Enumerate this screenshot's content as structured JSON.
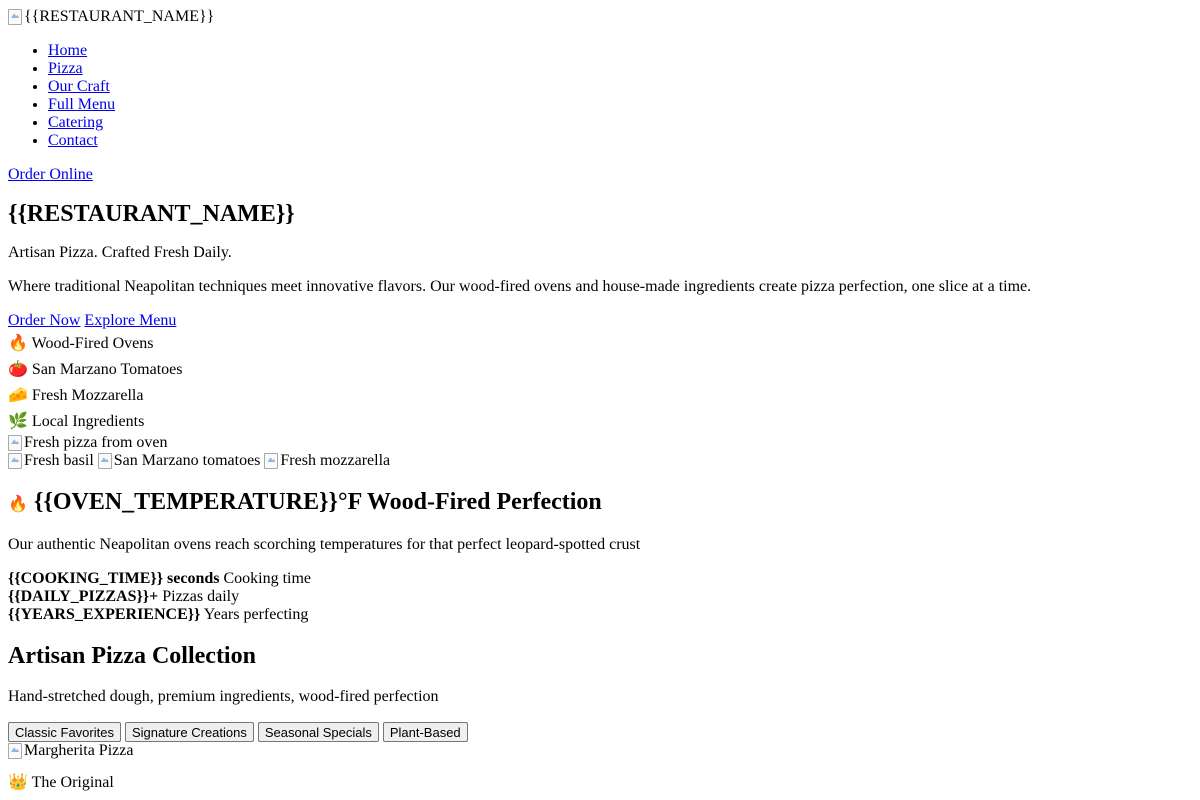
{
  "header": {
    "logo_alt": "{{RESTAURANT_NAME}}",
    "nav": [
      {
        "label": "Home"
      },
      {
        "label": "Pizza"
      },
      {
        "label": "Our Craft"
      },
      {
        "label": "Full Menu"
      },
      {
        "label": "Catering"
      },
      {
        "label": "Contact"
      }
    ],
    "order_online": "Order Online"
  },
  "hero": {
    "title": "{{RESTAURANT_NAME}}",
    "tagline": "Artisan Pizza. Crafted Fresh Daily.",
    "description": "Where traditional Neapolitan techniques meet innovative flavors. Our wood-fired ovens and house-made ingredients create pizza perfection, one slice at a time.",
    "order_now": "Order Now",
    "explore_menu": "Explore Menu",
    "features": [
      {
        "icon": "🔥",
        "icon_name": "fire-icon",
        "label": "Wood-Fired Ovens"
      },
      {
        "icon": "🍅",
        "icon_name": "tomato-icon",
        "label": "San Marzano Tomatoes"
      },
      {
        "icon": "🧀",
        "icon_name": "cheese-icon",
        "label": "Fresh Mozzarella"
      },
      {
        "icon": "🌿",
        "icon_name": "herb-icon",
        "label": "Local Ingredients"
      }
    ],
    "main_image_alt": "Fresh pizza from oven",
    "ingredient_images": [
      {
        "alt": "Fresh basil"
      },
      {
        "alt": "San Marzano tomatoes"
      },
      {
        "alt": "Fresh mozzarella"
      }
    ]
  },
  "oven": {
    "icon": "🔥",
    "title": "{{OVEN_TEMPERATURE}}°F Wood-Fired Perfection",
    "description": "Our authentic Neapolitan ovens reach scorching temperatures for that perfect leopard-spotted crust",
    "stats": [
      {
        "value": "{{COOKING_TIME}} seconds",
        "label": "Cooking time"
      },
      {
        "value": "{{DAILY_PIZZAS}}+",
        "label": "Pizzas daily"
      },
      {
        "value": "{{YEARS_EXPERIENCE}}",
        "label": "Years perfecting"
      }
    ]
  },
  "collection": {
    "title": "Artisan Pizza Collection",
    "subtitle": "Hand-stretched dough, premium ingredients, wood-fired perfection",
    "tabs": [
      {
        "label": "Classic Favorites"
      },
      {
        "label": "Signature Creations"
      },
      {
        "label": "Seasonal Specials"
      },
      {
        "label": "Plant-Based"
      }
    ],
    "items": [
      {
        "image_alt": "Margherita Pizza",
        "badge_icon": "👑",
        "badge": "The Original"
      }
    ]
  },
  "colors": {
    "link": "#0000ee",
    "text": "#000000",
    "background": "#ffffff"
  }
}
